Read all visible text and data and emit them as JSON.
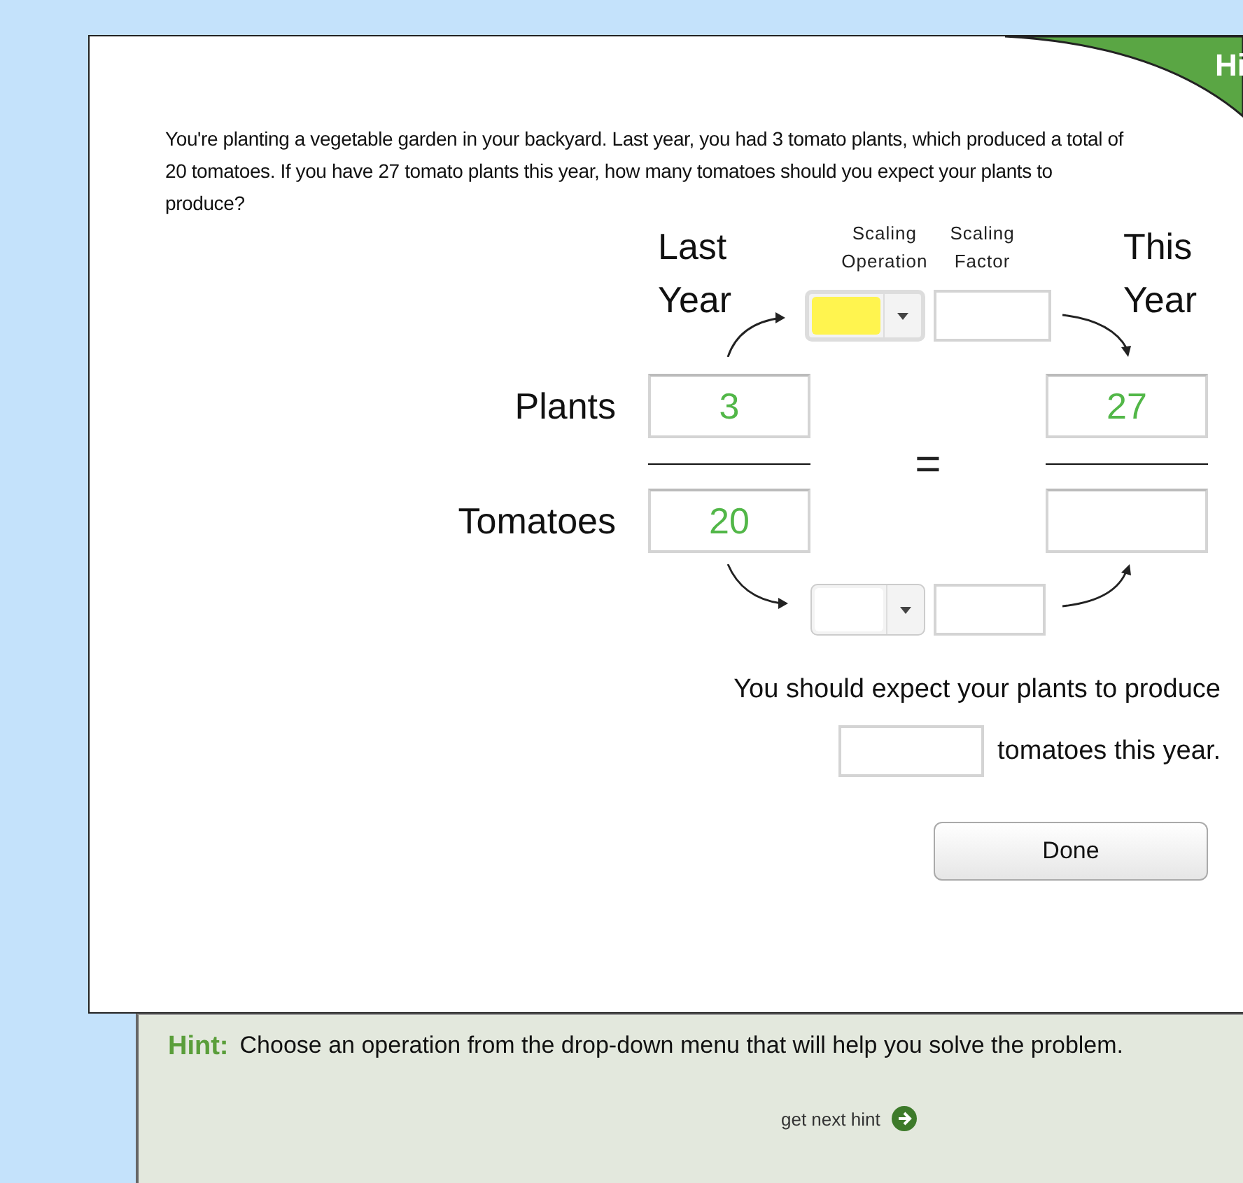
{
  "hint_tab": {
    "label": "Hi"
  },
  "question": "You're planting a vegetable garden in your backyard. Last year, you had 3 tomato plants, which produced a total of 20 tomatoes. If you have 27 tomato plants this year, how many tomatoes should you expect your plants to produce?",
  "columns": {
    "last": [
      "Last",
      "Year"
    ],
    "operation": [
      "Scaling",
      "Operation"
    ],
    "factor": [
      "Scaling",
      "Factor"
    ],
    "this": [
      "This",
      "Year"
    ]
  },
  "rows": [
    {
      "label": "Plants",
      "last": "3",
      "this": "27"
    },
    {
      "label": "Tomatoes",
      "last": "20"
    }
  ],
  "operations": [
    {
      "highlighted": true
    },
    {
      "highlighted": false
    }
  ],
  "equals": "=",
  "answer": {
    "prompt": "You should expect your plants to produce",
    "suffix": "tomatoes this year."
  },
  "done_button": "Done",
  "hint": {
    "label": "Hint:",
    "text": "Choose an operation from the drop-down menu that will help you solve the problem.",
    "next": "get next hint"
  }
}
